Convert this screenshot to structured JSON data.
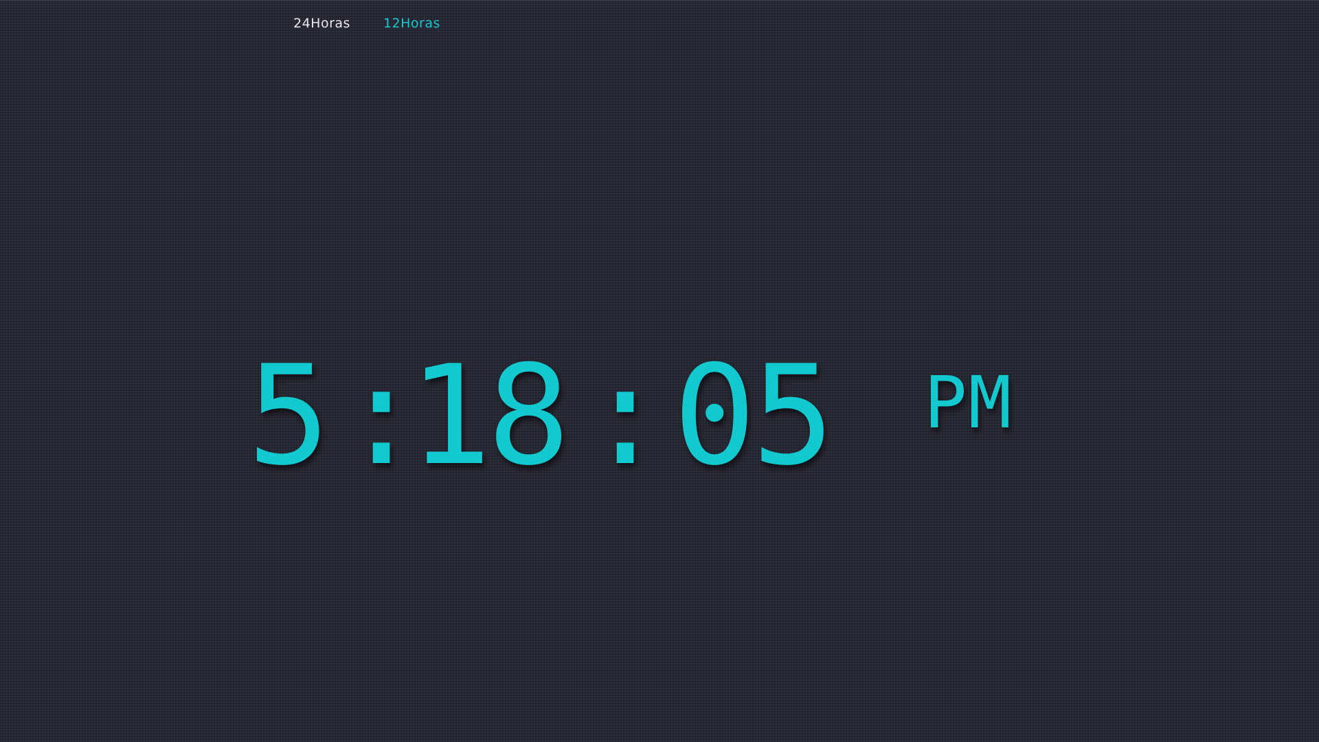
{
  "nav": {
    "tab_24": "24Horas",
    "tab_12": "12Horas",
    "active_tab": "12Horas"
  },
  "clock": {
    "hours": "5",
    "separator_1": ":",
    "minutes": "18",
    "separator_2": ":",
    "seconds": "05",
    "period": "PM"
  },
  "colors": {
    "background": "#262833",
    "accent": "#12c9cf",
    "inactive_text": "#e8e8ee"
  }
}
